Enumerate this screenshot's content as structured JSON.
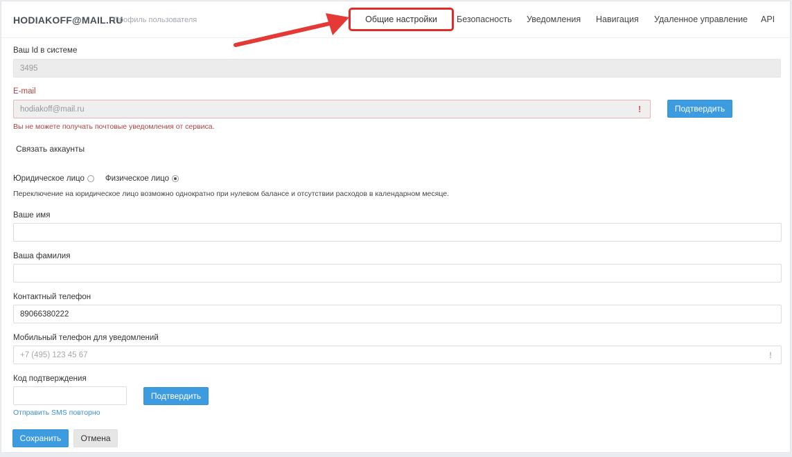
{
  "header": {
    "user_email": "HODIAKOFF@MAIL.RU",
    "subtitle": "Профиль пользователя",
    "tabs": [
      {
        "label": "Общие настройки"
      },
      {
        "label": "Безопасность"
      },
      {
        "label": "Уведомления"
      },
      {
        "label": "Навигация"
      },
      {
        "label": "Удаленное управление"
      },
      {
        "label": "API"
      }
    ]
  },
  "form": {
    "user_id": {
      "label": "Ваш Id в системе",
      "value": "3495"
    },
    "email": {
      "label": "E-mail",
      "value": "hodiakoff@mail.ru",
      "warning_mark": "!",
      "confirm_label": "Подтвердить",
      "error_text": "Вы не можете получать почтовые уведомления от сервиса."
    },
    "link_accounts_label": "Связать аккаунты",
    "entity_type": {
      "options": [
        {
          "label": "Юридическое лицо",
          "selected": false
        },
        {
          "label": "Физическое лицо",
          "selected": true
        }
      ],
      "hint": "Переключение на юридическое лицо возможно однократно при нулевом балансе и отсутствии расходов в календарном месяце."
    },
    "first_name": {
      "label": "Ваше имя",
      "value": ""
    },
    "last_name": {
      "label": "Ваша фамилия",
      "value": ""
    },
    "phone": {
      "label": "Контактный телефон",
      "value": "89066380222"
    },
    "mobile_phone": {
      "label": "Мобильный телефон для уведомлений",
      "placeholder": "+7 (495) 123 45 67",
      "warning_mark": "!"
    },
    "confirm_code": {
      "label": "Код подтверждения",
      "value": "",
      "confirm_label": "Подтвердить",
      "resend_label": "Отправить SMS повторно"
    },
    "save_label": "Сохранить",
    "cancel_label": "Отмена"
  },
  "annotation": {
    "arrow_color": "#e53935",
    "highlight_color": "#e22a2a"
  },
  "colors": {
    "primary": "#3d9be0",
    "error": "#a94442",
    "link": "#3a8fd1"
  }
}
